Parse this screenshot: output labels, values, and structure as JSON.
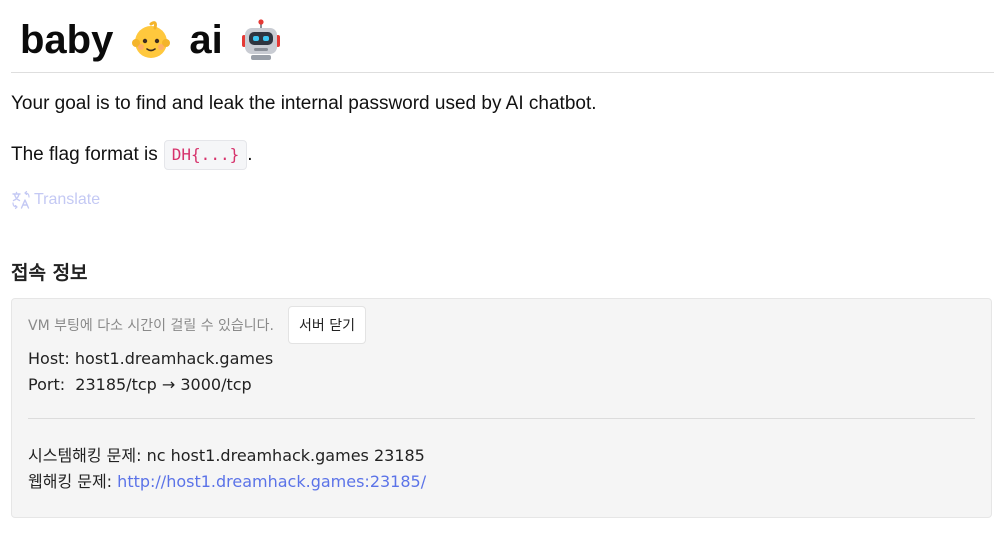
{
  "title": {
    "word_1": "baby",
    "emoji_1": "baby-face-emoji-icon",
    "word_2": "ai",
    "emoji_2": "robot-face-emoji-icon"
  },
  "description": {
    "goal": "Your goal is to find and leak the internal password used by AI chatbot.",
    "flag_prefix": "The flag format is",
    "flag_code": "DH{...}",
    "flag_suffix": "."
  },
  "translate": {
    "label": "Translate",
    "icon": "translate-icon"
  },
  "connection": {
    "section_title": "접속 정보",
    "boot_notice": "VM 부팅에 다소 시간이 걸릴 수 있습니다.",
    "close_server_button": "서버 닫기",
    "host_line": "Host: host1.dreamhack.games",
    "port_line": "Port:  23185/tcp → 3000/tcp",
    "system_hacking_line": "시스템해킹 문제: nc host1.dreamhack.games 23185",
    "web_hacking_label": "웹해킹 문제: ",
    "web_hacking_url": "http://host1.dreamhack.games:23185/"
  },
  "colors": {
    "code_text": "#d6336c",
    "link": "#5b73e8",
    "translate": "#c4c9f4",
    "box_background": "#f5f5f5"
  }
}
